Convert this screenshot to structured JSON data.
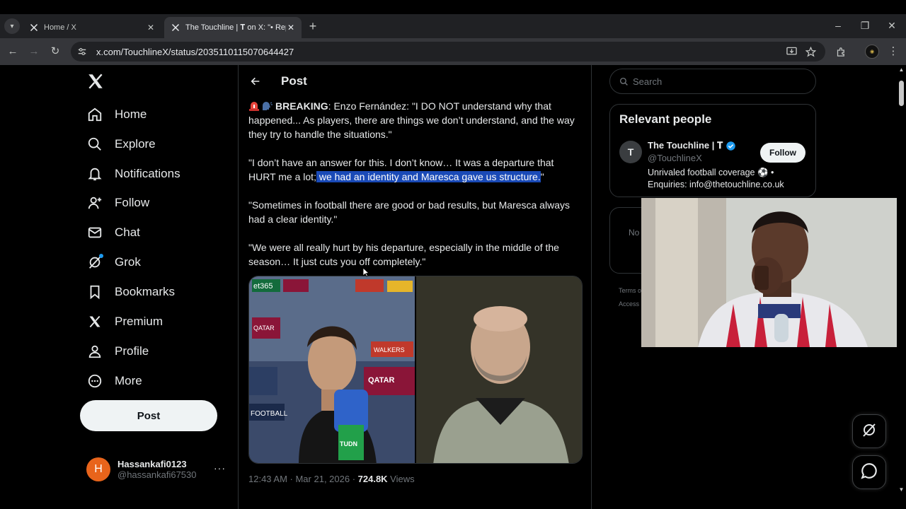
{
  "browser": {
    "tabs": [
      {
        "title": "Home / X",
        "active": false
      },
      {
        "title": "The Touchline | 𝐓 on X: \"• Repo",
        "active": true
      }
    ],
    "url": "x.com/TouchlineX/status/2035110115070644427"
  },
  "sidebar": {
    "items": [
      {
        "label": "Home",
        "icon": "home-icon"
      },
      {
        "label": "Explore",
        "icon": "search-icon"
      },
      {
        "label": "Notifications",
        "icon": "bell-icon"
      },
      {
        "label": "Follow",
        "icon": "add-person-icon"
      },
      {
        "label": "Chat",
        "icon": "envelope-icon"
      },
      {
        "label": "Grok",
        "icon": "grok-icon"
      },
      {
        "label": "Bookmarks",
        "icon": "bookmark-icon"
      },
      {
        "label": "Premium",
        "icon": "x-logo-icon"
      },
      {
        "label": "Profile",
        "icon": "person-icon"
      },
      {
        "label": "More",
        "icon": "more-circle-icon"
      }
    ],
    "post_button": "Post",
    "account": {
      "initial": "H",
      "name": "Hassankafi0123",
      "handle": "@hassankafi67530",
      "more": "···"
    }
  },
  "main": {
    "title": "Post",
    "tweet": {
      "label_breaking": "BREAKING",
      "p1_rest": ": Enzo Fernández: \"I DO NOT understand why that happened... As players, there are things we don’t understand, and the way they try to handle the situations.\"",
      "p2_pre": "\"I don’t have an answer for this. I don’t know… It was a departure that HURT me a lot;",
      "p2_highlight": " we had an identity and Maresca gave us structure.",
      "p2_post": "\"",
      "p3": "\"Sometimes in football there are good or bad results, but Maresca always had a clear identity.\"",
      "p4": "\"We were all really hurt by his departure, especially in the middle of the season… It just cuts you off completely.\""
    },
    "image_text": {
      "left_top": "et365",
      "qatar": "QATAR",
      "fotball": "FOOTBALL",
      "tudn": "TUDN",
      "walkers": "WALKERS"
    },
    "meta": {
      "time": "12:43 AM · Mar 21, 2026 · ",
      "views_count": "724.8K",
      "views_label": " Views"
    }
  },
  "right": {
    "search_placeholder": "Search",
    "relevant_title": "Relevant people",
    "person": {
      "avatar": "T",
      "name": "The Touchline | 𝐓",
      "handle": "@TouchlineX",
      "follow": "Follow",
      "bio": "Unrivaled football coverage ⚽ • Enquiries: info@thetouchline.co.uk"
    },
    "trend_text": "No",
    "footer1": "Terms o",
    "footer2": "Access"
  },
  "colors": {
    "accent": "#1d9bf0",
    "highlight": "#1a4ab7",
    "background": "#000000",
    "text": "#e7e9ea",
    "muted": "#71767b"
  }
}
